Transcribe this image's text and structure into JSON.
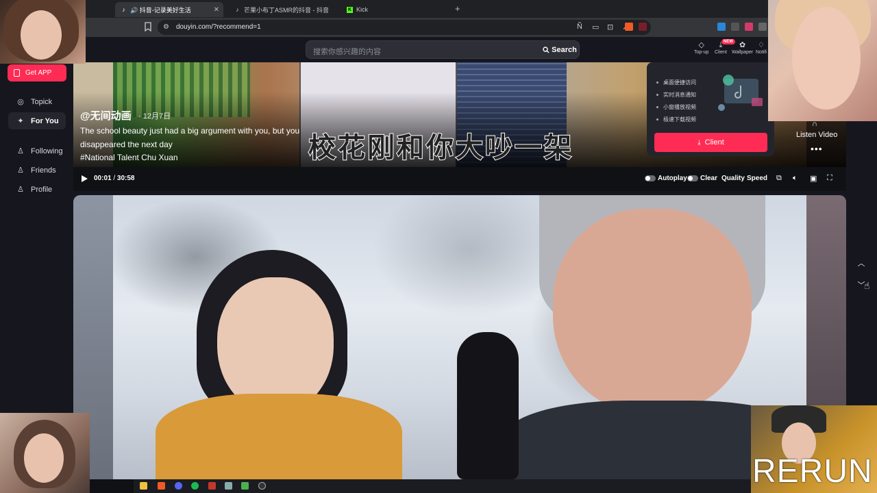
{
  "browser": {
    "tabs": [
      {
        "label": "🔊 抖音-记录美好生活",
        "active": true,
        "icon": "tiktok-icon"
      },
      {
        "label": "芒果小布丁ASMR的抖音 - 抖音",
        "active": false,
        "icon": "tiktok-icon"
      },
      {
        "label": "Kick",
        "active": false,
        "icon": "kick-icon"
      }
    ],
    "url": "douyin.com/?recommend=1"
  },
  "search": {
    "placeholder": "搜索你感兴趣的内容",
    "button": "Search"
  },
  "topnav": [
    {
      "label": "Top-up",
      "icon": "diamond-icon"
    },
    {
      "label": "Client",
      "icon": "download-icon",
      "badge": "NEW"
    },
    {
      "label": "Wallpaper",
      "icon": "wallpaper-icon"
    },
    {
      "label": "Notifi",
      "icon": "bell-icon"
    }
  ],
  "sidebar": {
    "get_app": "Get APP",
    "items": [
      {
        "label": "Topick",
        "icon": "compass-icon",
        "active": false
      },
      {
        "label": "For You",
        "icon": "sparkle-icon",
        "active": true
      },
      {
        "label": "Following",
        "icon": "following-icon",
        "active": false
      },
      {
        "label": "Friends",
        "icon": "friends-icon",
        "active": false
      },
      {
        "label": "Profile",
        "icon": "profile-icon",
        "active": false
      }
    ]
  },
  "video1": {
    "author": "@无间动画",
    "date": "12月7日",
    "desc_line1": "The school beauty just had a big argument with you, but you",
    "desc_line2": "disappeared the next day",
    "hashtag": "#National Talent Chu Xuan",
    "subtitle": "校花刚和你大吵一架",
    "listen": "Listen Video"
  },
  "player": {
    "current": "00:01",
    "separator": " / ",
    "total": "30:58",
    "autoplay": "Autoplay",
    "clear": "Clear",
    "quality": "Quality",
    "speed": "Speed"
  },
  "client_popup": {
    "features": [
      "桌面便捷访问",
      "实时消息通知",
      "小窗播放视频",
      "极速下载视频"
    ],
    "button": "Client"
  },
  "overlay": {
    "rerun": "RERUN"
  }
}
